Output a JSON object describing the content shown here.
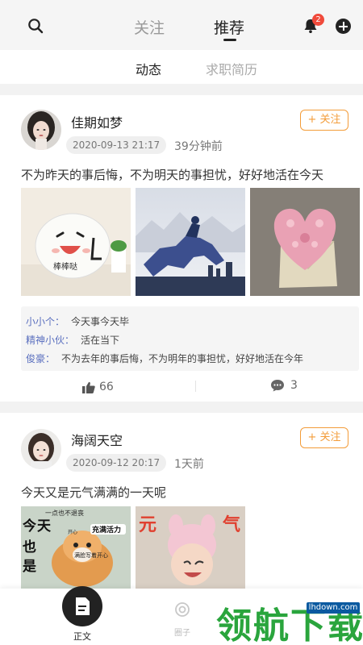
{
  "header": {
    "tabs": [
      {
        "label": "关注",
        "active": false
      },
      {
        "label": "推荐",
        "active": true
      }
    ],
    "notification_count": "2"
  },
  "subtabs": [
    {
      "label": "动态",
      "active": true
    },
    {
      "label": "求职简历",
      "active": false
    }
  ],
  "posts": [
    {
      "username": "佳期如梦",
      "date": "2020-09-13 21:17",
      "ago": "39分钟前",
      "follow_label": "+ 关注",
      "text": "不为昨天的事后悔，不为明天的事担忧，好好地活在今天",
      "comments": [
        {
          "name": "小小个：",
          "text": "今天事今天毕"
        },
        {
          "name": "精神小伙：",
          "text": "活在当下"
        },
        {
          "name": "俊豪：",
          "text": "不为去年的事后悔，不为明年的事担忧，好好地活在今年"
        }
      ],
      "likes": "66",
      "comment_count": "3"
    },
    {
      "username": "海阔天空",
      "date": "2020-09-12 20:17",
      "ago": "1天前",
      "follow_label": "+ 关注",
      "text": "今天又是元气满满的一天呢"
    }
  ],
  "image_text": {
    "bangbangda": "棒棒哒",
    "cat_top": "一点也不退丧",
    "cat_big": [
      "今",
      "天",
      "也",
      "是"
    ],
    "cat_badge": "充满活力",
    "cat_bottom": "满脸写着开心",
    "cat_side": "开心",
    "girl_left": "元",
    "girl_right": "气"
  },
  "bottom_nav": {
    "home_label": "正文",
    "circle_label": "圈子"
  },
  "watermark": {
    "text": "领航下载",
    "url": "lhdown.com"
  },
  "colors": {
    "accent": "#f39c39",
    "comment_name": "#5a6fbf",
    "badge": "#f04a3b",
    "watermark_green": "#2aa53d"
  }
}
